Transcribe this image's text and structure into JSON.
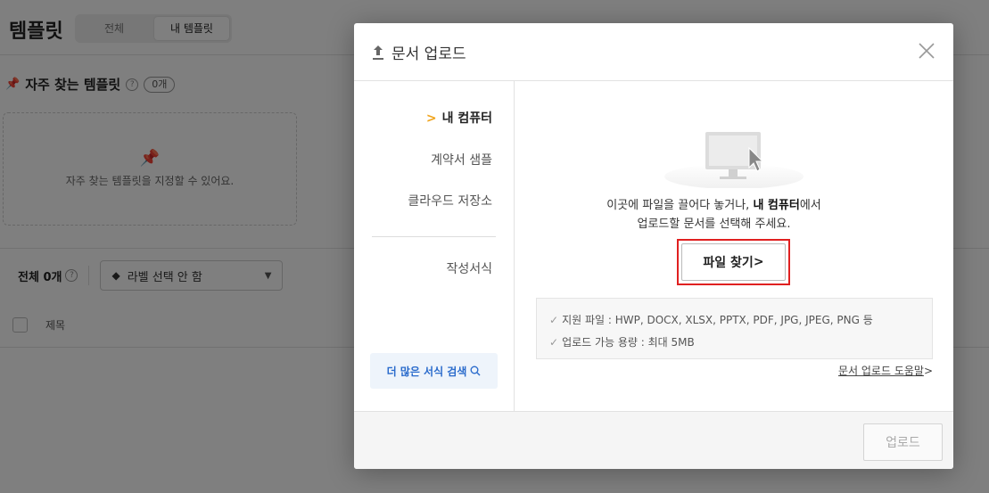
{
  "background": {
    "title": "템플릿",
    "tabs": [
      {
        "label": "전체"
      },
      {
        "label": "내 템플릿"
      }
    ],
    "favorites": {
      "title": "자주 찾는 템플릿",
      "count": "0개",
      "empty_message": "자주 찾는 템플릿을 지정할 수 있어요."
    },
    "filter": {
      "total": "전체 0개",
      "label_select": "라벨 선택 안 함"
    },
    "table": {
      "column_title": "제목"
    }
  },
  "modal": {
    "title": "문서 업로드",
    "sidebar": {
      "items": [
        {
          "label": "내 컴퓨터"
        },
        {
          "label": "계약서 샘플"
        },
        {
          "label": "클라우드 저장소"
        },
        {
          "label": "작성서식"
        }
      ],
      "more_button": "더 많은 서식 검색"
    },
    "main": {
      "drop_text_prefix": "이곳에 파일을 끌어다 놓거나, ",
      "drop_text_bold": "내 컴퓨터",
      "drop_text_suffix": "에서",
      "drop_text_line2": "업로드할 문서를 선택해 주세요.",
      "find_button": "파일 찾기",
      "supported_files": "지원 파일 : HWP, DOCX, XLSX, PPTX, PDF, JPG, JPEG, PNG 등",
      "max_size": "업로드 가능 용량 : 최대 5MB",
      "help_link": "문서 업로드 도움말"
    },
    "footer": {
      "upload_button": "업로드"
    }
  },
  "colors": {
    "accent_chevron": "#f0a41c",
    "link_blue": "#2a6bcc",
    "highlight_red": "#e02020"
  }
}
